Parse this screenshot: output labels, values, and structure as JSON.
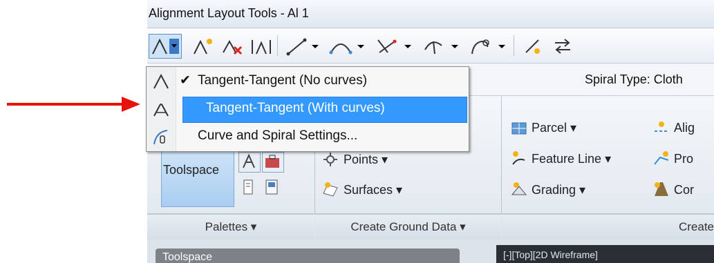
{
  "window": {
    "title": "Alignment Layout Tools - Al 1"
  },
  "propbar": {
    "spiral_type": "Spiral Type: Cloth"
  },
  "dropdown": {
    "items": [
      {
        "label": "Tangent-Tangent (No curves)",
        "checked": true,
        "icon": "tangent-icon"
      },
      {
        "label": "Tangent-Tangent (With curves)",
        "checked": false,
        "highlighted": true,
        "icon": "tangent-curves-icon"
      },
      {
        "label": "Curve and Spiral Settings...",
        "checked": false,
        "icon": "curve-settings-icon"
      }
    ],
    "check_glyph": "✔"
  },
  "ribbon": {
    "partial_data": "ata",
    "toolspace": "Toolspace",
    "points": "Points ▾",
    "surfaces": "Surfaces ▾",
    "parcel": "Parcel ▾",
    "feature_line": "Feature Line ▾",
    "grading": "Grading ▾",
    "alig": "Alig",
    "pro": "Pro",
    "cor": "Cor"
  },
  "footers": {
    "palettes": "Palettes ▾",
    "create_ground_data": "Create Ground Data ▾",
    "create": "Create"
  },
  "bottom": {
    "palette_tab": "Toolspace",
    "dark_tab": "[-][Top][2D Wireframe]"
  },
  "annotation": {
    "arrow_color": "#e8120c"
  },
  "colors": {
    "highlight": "#3399ff",
    "toolspace_bg": "#a9cdf0"
  }
}
